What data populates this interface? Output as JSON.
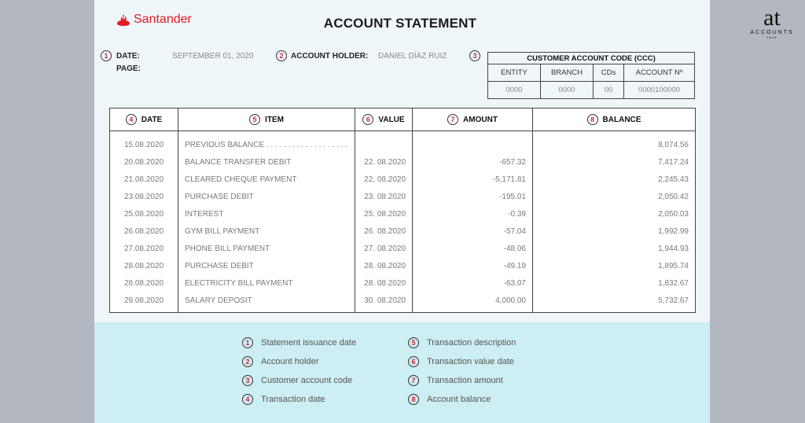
{
  "brand": {
    "name": "Santander",
    "color": "#e31b23"
  },
  "title": "ACCOUNT STATEMENT",
  "header": {
    "date_label": "DATE:",
    "date_value": "SEPTEMBER 01, 2020",
    "page_label": "PAGE:",
    "holder_label": "ACCOUNT HOLDER:",
    "holder_value": "DANIEL DÍAZ RUIZ"
  },
  "ccc": {
    "caption": "CUSTOMER ACCOUNT CODE (CCC)",
    "headers": [
      "ENTITY",
      "BRANCH",
      "CDs",
      "ACCOUNT Nº"
    ],
    "values": [
      "0000",
      "0000",
      "00",
      "0000100000"
    ]
  },
  "badges": [
    "1",
    "2",
    "3",
    "4",
    "5",
    "6",
    "7",
    "8"
  ],
  "table": {
    "columns": [
      "DATE",
      "ITEM",
      "VALUE",
      "AMOUNT",
      "BALANCE"
    ],
    "rows": [
      {
        "date": "15.08.2020",
        "item": "PREVIOUS BALANCE . . . . . . . . . . . . . . . . . . .",
        "value": "",
        "amount": "",
        "balance": "8,074.56"
      },
      {
        "date": "20.08.2020",
        "item": "BALANCE TRANSFER DEBIT",
        "value": "22. 08.2020",
        "amount": "-657.32",
        "balance": "7,417.24"
      },
      {
        "date": "21.08.2020",
        "item": "CLEARED CHEQUE PAYMENT",
        "value": "22. 08.2020",
        "amount": "-5,171.81",
        "balance": "2,245.43"
      },
      {
        "date": "23.08.2020",
        "item": "PURCHASE DEBIT",
        "value": "23. 08.2020",
        "amount": "-195.01",
        "balance": "2,050.42"
      },
      {
        "date": "25.08.2020",
        "item": "INTEREST",
        "value": "25. 08.2020",
        "amount": "-0.39",
        "balance": "2,050.03"
      },
      {
        "date": "26.08.2020",
        "item": "GYM BILL PAYMENT",
        "value": "26. 08.2020",
        "amount": "-57.04",
        "balance": "1,992.99"
      },
      {
        "date": "27.08.2020",
        "item": "PHONE BILL PAYMENT",
        "value": "27. 08.2020",
        "amount": "-48.06",
        "balance": "1,944.93"
      },
      {
        "date": "28.08.2020",
        "item": "PURCHASE DEBIT",
        "value": "28. 08.2020",
        "amount": "-49.19",
        "balance": "1,895.74"
      },
      {
        "date": "28.08.2020",
        "item": "ELECTRICITY BILL PAYMENT",
        "value": "28. 08.2020",
        "amount": "-63.07",
        "balance": "1,832.67"
      },
      {
        "date": "29.08.2020",
        "item": "SALARY DEPOSIT",
        "value": "30. 08.2020",
        "amount": "4,000.00",
        "balance": "5,732.67"
      }
    ]
  },
  "legend": [
    {
      "n": "1",
      "text": "Statement issuance date"
    },
    {
      "n": "2",
      "text": "Account holder"
    },
    {
      "n": "3",
      "text": "Customer account code"
    },
    {
      "n": "4",
      "text": "Transaction date"
    },
    {
      "n": "5",
      "text": "Transaction description"
    },
    {
      "n": "6",
      "text": "Transaction value date"
    },
    {
      "n": "7",
      "text": "Transaction amount"
    },
    {
      "n": "8",
      "text": "Account balance"
    }
  ],
  "watermark": {
    "mark": "at",
    "name": "ACCOUNTS",
    "sub": "TALK"
  }
}
